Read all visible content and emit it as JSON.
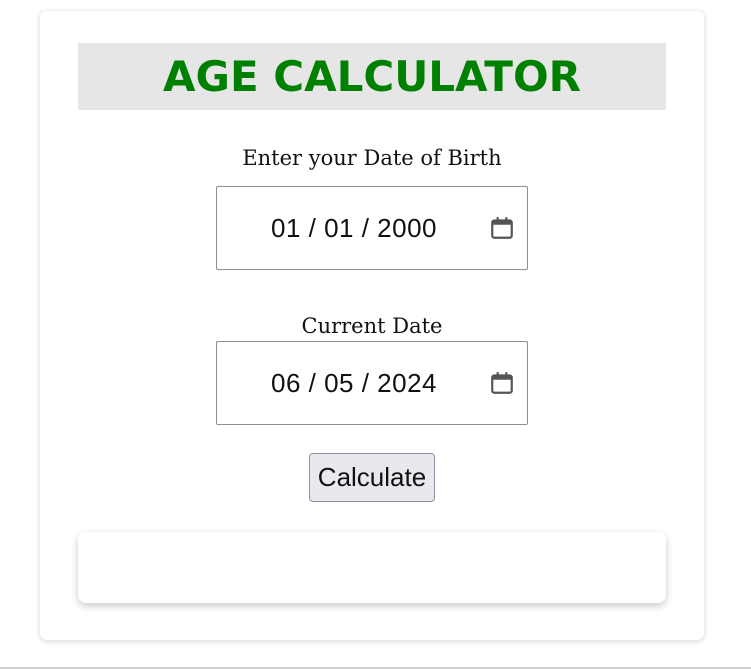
{
  "app": {
    "title": "AGE CALCULATOR",
    "title_color": "#008000"
  },
  "dob": {
    "label": "Enter your Date of Birth",
    "value": "01 / 01 / 2000",
    "icon": "calendar-icon"
  },
  "current": {
    "label": "Current Date",
    "value": "06 / 05 / 2024",
    "icon": "calendar-icon"
  },
  "actions": {
    "calculate_label": "Calculate"
  },
  "result": {
    "text": ""
  }
}
